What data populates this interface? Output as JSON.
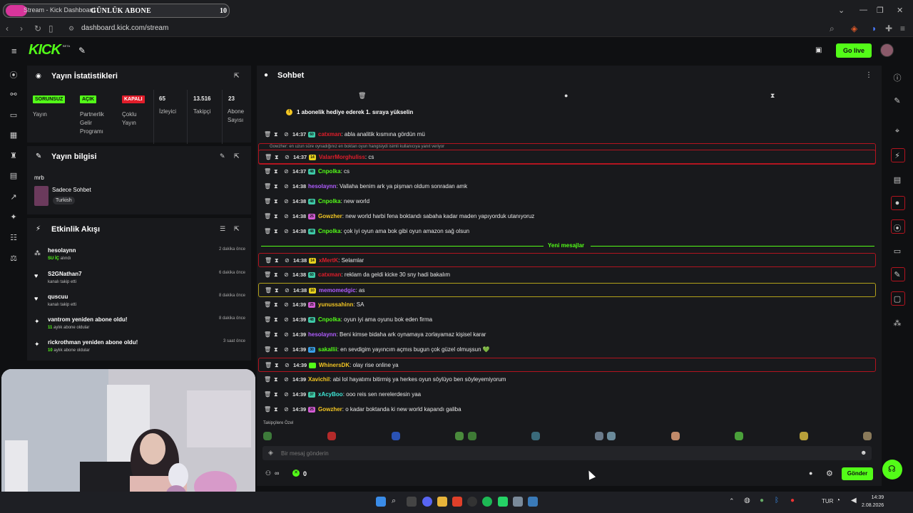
{
  "browser": {
    "tab_title": "Stream - Kick Dashboard",
    "overlay_goal_label": "GÜNLÜK ABONE",
    "overlay_goal_count": "10",
    "url": "dashboard.kick.com/stream"
  },
  "header": {
    "logo": "KICK",
    "beta": "BETA",
    "go_live": "Go live"
  },
  "stream_stats": {
    "title": "Yayın İstatistikleri",
    "items": [
      {
        "badge": "SORUNSUZ",
        "label": "Yayın",
        "badge_color": "#53fc18"
      },
      {
        "badge": "AÇIK",
        "label": "Partnerlik Gelir Programı",
        "badge_color": "#53fc18"
      },
      {
        "badge": "KAPALI",
        "label": "Çoklu Yayın",
        "badge_color": "#e11d2a"
      },
      {
        "value": "65",
        "label": "İzleyici"
      },
      {
        "value": "13.516",
        "label": "Takipçi"
      },
      {
        "value": "23",
        "label": "Abone Sayısı"
      }
    ]
  },
  "stream_info": {
    "title": "Yayın bilgisi",
    "stream_title": "mrb",
    "category": "Sadece Sohbet",
    "language": "Turkish"
  },
  "activity": {
    "title": "Etkinlik Akışı",
    "events": [
      {
        "name": "hesolaynn",
        "detail_em": "SU İÇ",
        "detail": " alındı",
        "time": "2 dakika önce"
      },
      {
        "name": "S2GNathan7",
        "detail": "kanalı takip etti",
        "time": "6 dakika önce"
      },
      {
        "name": "quscuu",
        "detail": "kanalı takip etti",
        "time": "8 dakika önce"
      },
      {
        "name": "vantrom yeniden abone oldu!",
        "detail_em": "11",
        "detail": " aylık abone oldular",
        "time": "8 dakika önce"
      },
      {
        "name": "rickrothman yeniden abone oldu!",
        "detail_em": "10",
        "detail": " aylık abone oldular",
        "time": "3 saat önce"
      }
    ]
  },
  "chat": {
    "title": "Sohbet",
    "pinned": "1 abonelik hediye ederek 1. sıraya yükselin",
    "reply_note": "Gowzher: en uzun süre oynadığınız en boktan oyun hangisiydi isimli kullanıcıya yanıt veriyor",
    "new_messages_label": "Yeni mesajlar",
    "messages": [
      {
        "time": "14:37",
        "badge": "60",
        "badge_color": "#3ec9a7",
        "user": "catxman",
        "color": "#e11d2a",
        "text": ": abla analitik kısmına gördün mü",
        "hl": ""
      },
      {
        "time": "14:37",
        "badge": "14",
        "badge_color": "#e8d21d",
        "user": "ValarrMorghuliss",
        "color": "#e11d2a",
        "text": ": cs",
        "hl": "red"
      },
      {
        "time": "14:37",
        "badge": "48",
        "badge_color": "#3ec9a7",
        "user": "Cnpolka",
        "color": "#53fc18",
        "text": ": cs",
        "hl": ""
      },
      {
        "time": "14:38",
        "badge": "",
        "badge_color": "",
        "user": "hesolaynn",
        "color": "#b05cff",
        "text": ": Vallaha benim ark ya pişman oldum sonradan amk",
        "hl": ""
      },
      {
        "time": "14:38",
        "badge": "48",
        "badge_color": "#3ec9a7",
        "user": "Cnpolka",
        "color": "#53fc18",
        "text": ": new world",
        "hl": ""
      },
      {
        "time": "14:38",
        "badge": "25",
        "badge_color": "#d35bd3",
        "user": "Gowzher",
        "color": "#f3c623",
        "text": ": new world harbi fena boktandı sabaha kadar maden yapıyorduk utanıyoruz",
        "hl": ""
      },
      {
        "time": "14:38",
        "badge": "48",
        "badge_color": "#3ec9a7",
        "user": "Cnpolka",
        "color": "#53fc18",
        "text": ": çok iyi oyun ama bok gibi oyun amazon sağ olsun",
        "hl": ""
      },
      {
        "time": "14:38",
        "badge": "14",
        "badge_color": "#e8d21d",
        "user": "xMertK",
        "color": "#e11d2a",
        "text": ": Selamlar",
        "hl": "red"
      },
      {
        "time": "14:38",
        "badge": "60",
        "badge_color": "#3ec9a7",
        "user": "catxman",
        "color": "#e11d2a",
        "text": ": reklam da geldi kicke 30 sny hadi bakalım",
        "hl": ""
      },
      {
        "time": "14:38",
        "badge": "10",
        "badge_color": "#e8d21d",
        "user": "memomedgic",
        "color": "#b05cff",
        "text": ": as",
        "hl": "yel"
      },
      {
        "time": "14:39",
        "badge": "25",
        "badge_color": "#d35bd3",
        "user": "yunussahinn",
        "color": "#f3c623",
        "text": ": SA",
        "hl": ""
      },
      {
        "time": "14:39",
        "badge": "48",
        "badge_color": "#3ec9a7",
        "user": "Cnpolka",
        "color": "#53fc18",
        "text": ": oyun iyi ama oyunu bok eden firma",
        "hl": ""
      },
      {
        "time": "14:39",
        "badge": "",
        "badge_color": "",
        "user": "hesolaynn",
        "color": "#b05cff",
        "text": ": Beni kimse bidaha ark oynamaya zorlayamaz kişisel karar",
        "hl": ""
      },
      {
        "time": "14:39",
        "badge": "30",
        "badge_color": "#3aa0e8",
        "user": "sakallii",
        "color": "#53fc18",
        "text": ": en sevdigim yayıncım açmıs bugun çok güzel olmuşsun 💚",
        "hl": ""
      },
      {
        "time": "14:39",
        "badge": "",
        "badge_color": "#53fc18",
        "user": "WhinersDK",
        "color": "#f3c623",
        "text": ": olay rise online ya",
        "hl": "red"
      },
      {
        "time": "14:39",
        "badge": "",
        "badge_color": "",
        "user": "Xavichil",
        "color": "#f3c623",
        "text": ": abi lol hayatımı bitirmiş ya herkes oyun söylüyo ben söyleyemiyorum",
        "hl": ""
      },
      {
        "time": "14:39",
        "badge": "37",
        "badge_color": "#3ec9a7",
        "user": "xAcyBoo",
        "color": "#3ee6d6",
        "text": ": ooo reis sen nerelerdesin yaa",
        "hl": ""
      },
      {
        "time": "14:39",
        "badge": "25",
        "badge_color": "#d35bd3",
        "user": "Gowzher",
        "color": "#f3c623",
        "text": ": o kadar boktanda ki new world kapandı galiba",
        "hl": ""
      }
    ],
    "emote_label": "Takipçilere Özel",
    "input_placeholder": "Bir mesaj gönderin",
    "points": "0",
    "send_label": "Gönder"
  },
  "taskbar": {
    "lang": "TUR",
    "time": "14:39",
    "date": "2.08.2026"
  }
}
